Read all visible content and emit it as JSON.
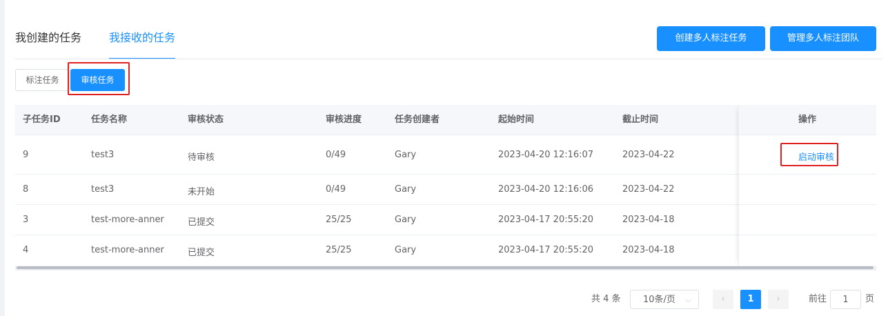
{
  "tabs": {
    "created": "我创建的任务",
    "received": "我接收的任务"
  },
  "actions": {
    "create_team_task": "创建多人标注任务",
    "manage_team": "管理多人标注团队"
  },
  "sub_tabs": {
    "annotate": "标注任务",
    "review": "审核任务"
  },
  "table": {
    "headers": {
      "subtask_id": "子任务ID",
      "name": "任务名称",
      "review_status": "审核状态",
      "review_progress": "审核进度",
      "creator": "任务创建者",
      "start_time": "起始时间",
      "end_time": "截止时间",
      "operation": "操作"
    },
    "rows": [
      {
        "id": "9",
        "name": "test3",
        "status": "待审核",
        "progress": "0/49",
        "creator": "Gary",
        "start": "2023-04-20 12:16:07",
        "end": "2023-04-22",
        "op": "启动审核"
      },
      {
        "id": "8",
        "name": "test3",
        "status": "未开始",
        "progress": "0/49",
        "creator": "Gary",
        "start": "2023-04-20 12:16:06",
        "end": "2023-04-22",
        "op": ""
      },
      {
        "id": "3",
        "name": "test-more-anner",
        "status": "已提交",
        "progress": "25/25",
        "creator": "Gary",
        "start": "2023-04-17 20:55:20",
        "end": "2023-04-18",
        "op": ""
      },
      {
        "id": "4",
        "name": "test-more-anner",
        "status": "已提交",
        "progress": "25/25",
        "creator": "Gary",
        "start": "2023-04-17 20:55:20",
        "end": "2023-04-18",
        "op": ""
      }
    ]
  },
  "pagination": {
    "total": "共 4 条",
    "page_size": "10条/页",
    "current_page": "1",
    "goto_label": "前往",
    "goto_value": "1",
    "goto_suffix": "页",
    "prev_icon": "chevron-left-icon",
    "next_icon": "chevron-right-icon"
  },
  "colors": {
    "primary": "#1890ff",
    "highlight": "#e02020"
  }
}
